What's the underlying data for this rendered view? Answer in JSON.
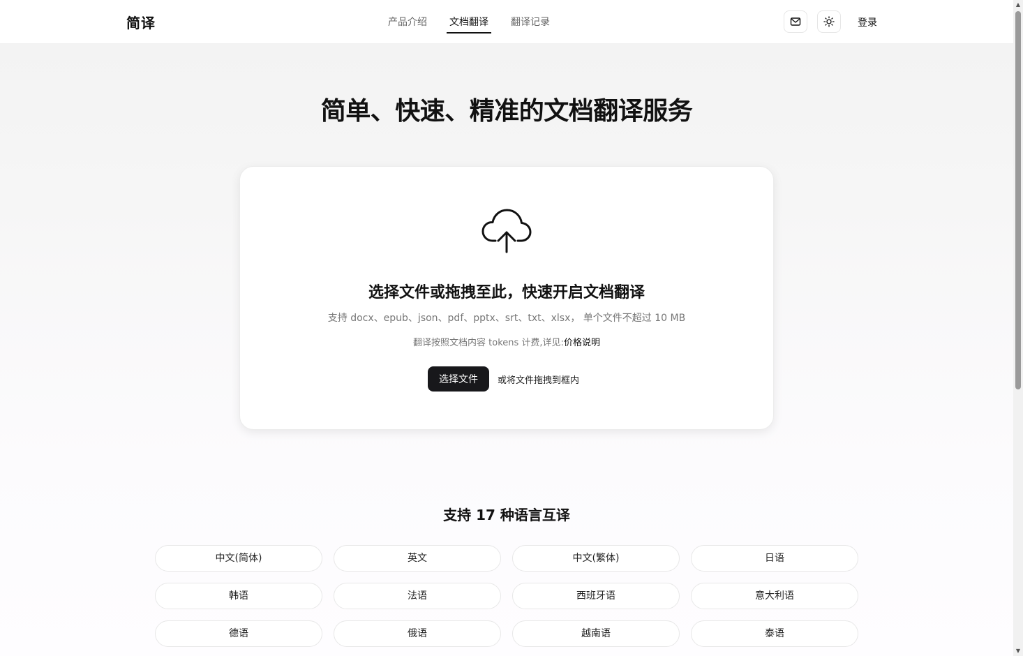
{
  "header": {
    "logo": "简译",
    "nav": [
      "产品介绍",
      "文档翻译",
      "翻译记录"
    ],
    "active_nav": "文档翻译",
    "login": "登录",
    "icons": [
      "mail-icon",
      "sun-icon"
    ]
  },
  "hero": {
    "title": "简单、快速、精准的文档翻译服务"
  },
  "upload": {
    "icon": "cloud-upload-icon",
    "title": "选择文件或拖拽至此，快速开启文档翻译",
    "formats": "支持 docx、epub、json、pdf、pptx、srt、txt、xlsx， 单个文件不超过 10 MB",
    "pricing_text": "翻译按照文档内容 tokens 计费,详见:",
    "pricing_link": "价格说明",
    "choose_button": "选择文件",
    "drag_hint": "或将文件拖拽到框内"
  },
  "languages": {
    "title": "支持 17 种语言互译",
    "items": [
      "中文(简体)",
      "英文",
      "中文(繁体)",
      "日语",
      "韩语",
      "法语",
      "西班牙语",
      "意大利语",
      "德语",
      "俄语",
      "越南语",
      "泰语"
    ]
  },
  "colors": {
    "primary_button": "#18181b",
    "text": "#111111",
    "muted": "#777777"
  }
}
